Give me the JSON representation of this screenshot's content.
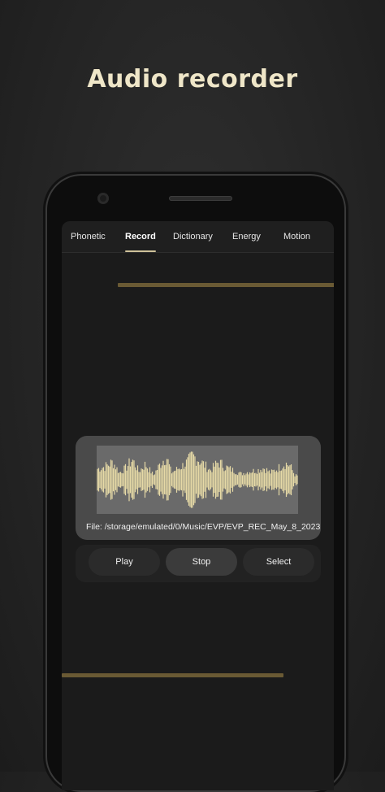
{
  "headline": "Audio recorder",
  "tabs": [
    {
      "label": "Phonetic",
      "selected": false
    },
    {
      "label": "Record",
      "selected": true
    },
    {
      "label": "Dictionary",
      "selected": false
    },
    {
      "label": "Energy",
      "selected": false
    },
    {
      "label": "Motion",
      "selected": false
    }
  ],
  "recorder": {
    "file_text": "File: /storage/emulated/0/Music/EVP/EVP_REC_May_8_2023",
    "waveform_color": "#e6d9a6",
    "play_label": "Play",
    "stop_label": "Stop",
    "select_label": "Select"
  },
  "colors": {
    "accent": "#cfc29a",
    "headline": "#efe6c8"
  }
}
